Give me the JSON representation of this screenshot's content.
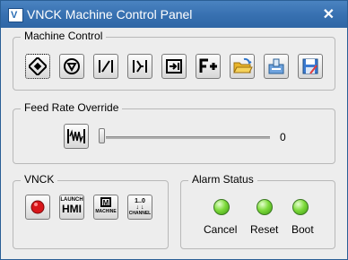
{
  "window": {
    "title": "VNCK Machine Control Panel",
    "icon_letter": "V",
    "close_glyph": "✕"
  },
  "machine_control": {
    "label": "Machine Control",
    "buttons": [
      "cycle-start-icon",
      "cycle-stop-icon",
      "feed-hold-icon",
      "single-block-icon",
      "program-select-icon",
      "f-plus-icon",
      "open-folder-icon",
      "load-tool-icon",
      "save-icon"
    ]
  },
  "feed_rate": {
    "label": "Feed Rate Override",
    "value": "0",
    "value_fraction": 0.0
  },
  "vnck": {
    "label": "VNCK",
    "launch_hmi_top": "LAUNCH",
    "launch_hmi_bottom": "HMI",
    "machine_label": "MACHINE",
    "channel_top": "1..0",
    "channel_label": "CHANNEL"
  },
  "alarm_status": {
    "label": "Alarm Status",
    "items": [
      {
        "label": "Cancel",
        "color": "#5fcf26"
      },
      {
        "label": "Reset",
        "color": "#5fcf26"
      },
      {
        "label": "Boot",
        "color": "#5fcf26"
      }
    ]
  }
}
